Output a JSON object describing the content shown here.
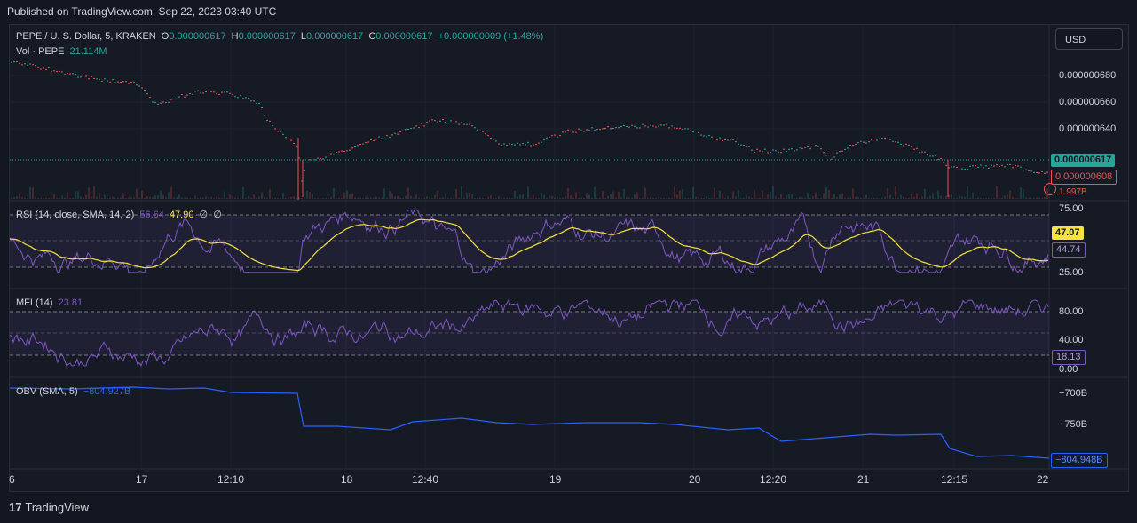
{
  "header": {
    "published": "Published on TradingView.com, Sep 22, 2023 03:40 UTC"
  },
  "symbol": {
    "name": "PEPE / U. S. Dollar, 5, KRAKEN",
    "o_label": "O",
    "o_value": "0.000000617",
    "h_label": "H",
    "h_value": "0.000000617",
    "l_label": "L",
    "l_value": "0.000000617",
    "c_label": "C",
    "c_value": "0.000000617",
    "change": "+0.000000009 (+1.48%)"
  },
  "volume": {
    "label": "Vol · PEPE",
    "value": "21.114M"
  },
  "currency_button": "USD",
  "price_axis": {
    "ticks": [
      "0.000000680",
      "0.000000660",
      "0.000000640"
    ],
    "last_price": "0.000000617",
    "prev_price": "0.000000608",
    "volume_tag": "1.997B"
  },
  "rsi": {
    "label": "RSI (14, close, SMA, 14, 2)",
    "rsi_value": "56.64",
    "ma_value": "47.90",
    "extra1": "∅",
    "extra2": "∅",
    "ticks": [
      "75.00",
      "25.00"
    ],
    "tag_yellow": "47.07",
    "tag_purple": "44.74"
  },
  "mfi": {
    "label": "MFI (14)",
    "value": "23.81",
    "ticks": [
      "80.00",
      "40.00",
      "0.00"
    ],
    "tag": "18.13"
  },
  "obv": {
    "label": "OBV (SMA, 5)",
    "value": "−804.927B",
    "ticks": [
      "−700B",
      "−750B"
    ],
    "tag": "−804.948B"
  },
  "time_axis": [
    "6",
    "17",
    "12:10",
    "18",
    "12:40",
    "19",
    "20",
    "12:20",
    "21",
    "12:15",
    "22"
  ],
  "footer": {
    "brand": "TradingView"
  },
  "colors": {
    "up": "#26a69a",
    "down": "#ef5350",
    "rsi": "#7e57c2",
    "rsi_ma": "#f7e33b",
    "obv": "#2962ff",
    "bg": "#131722"
  }
}
